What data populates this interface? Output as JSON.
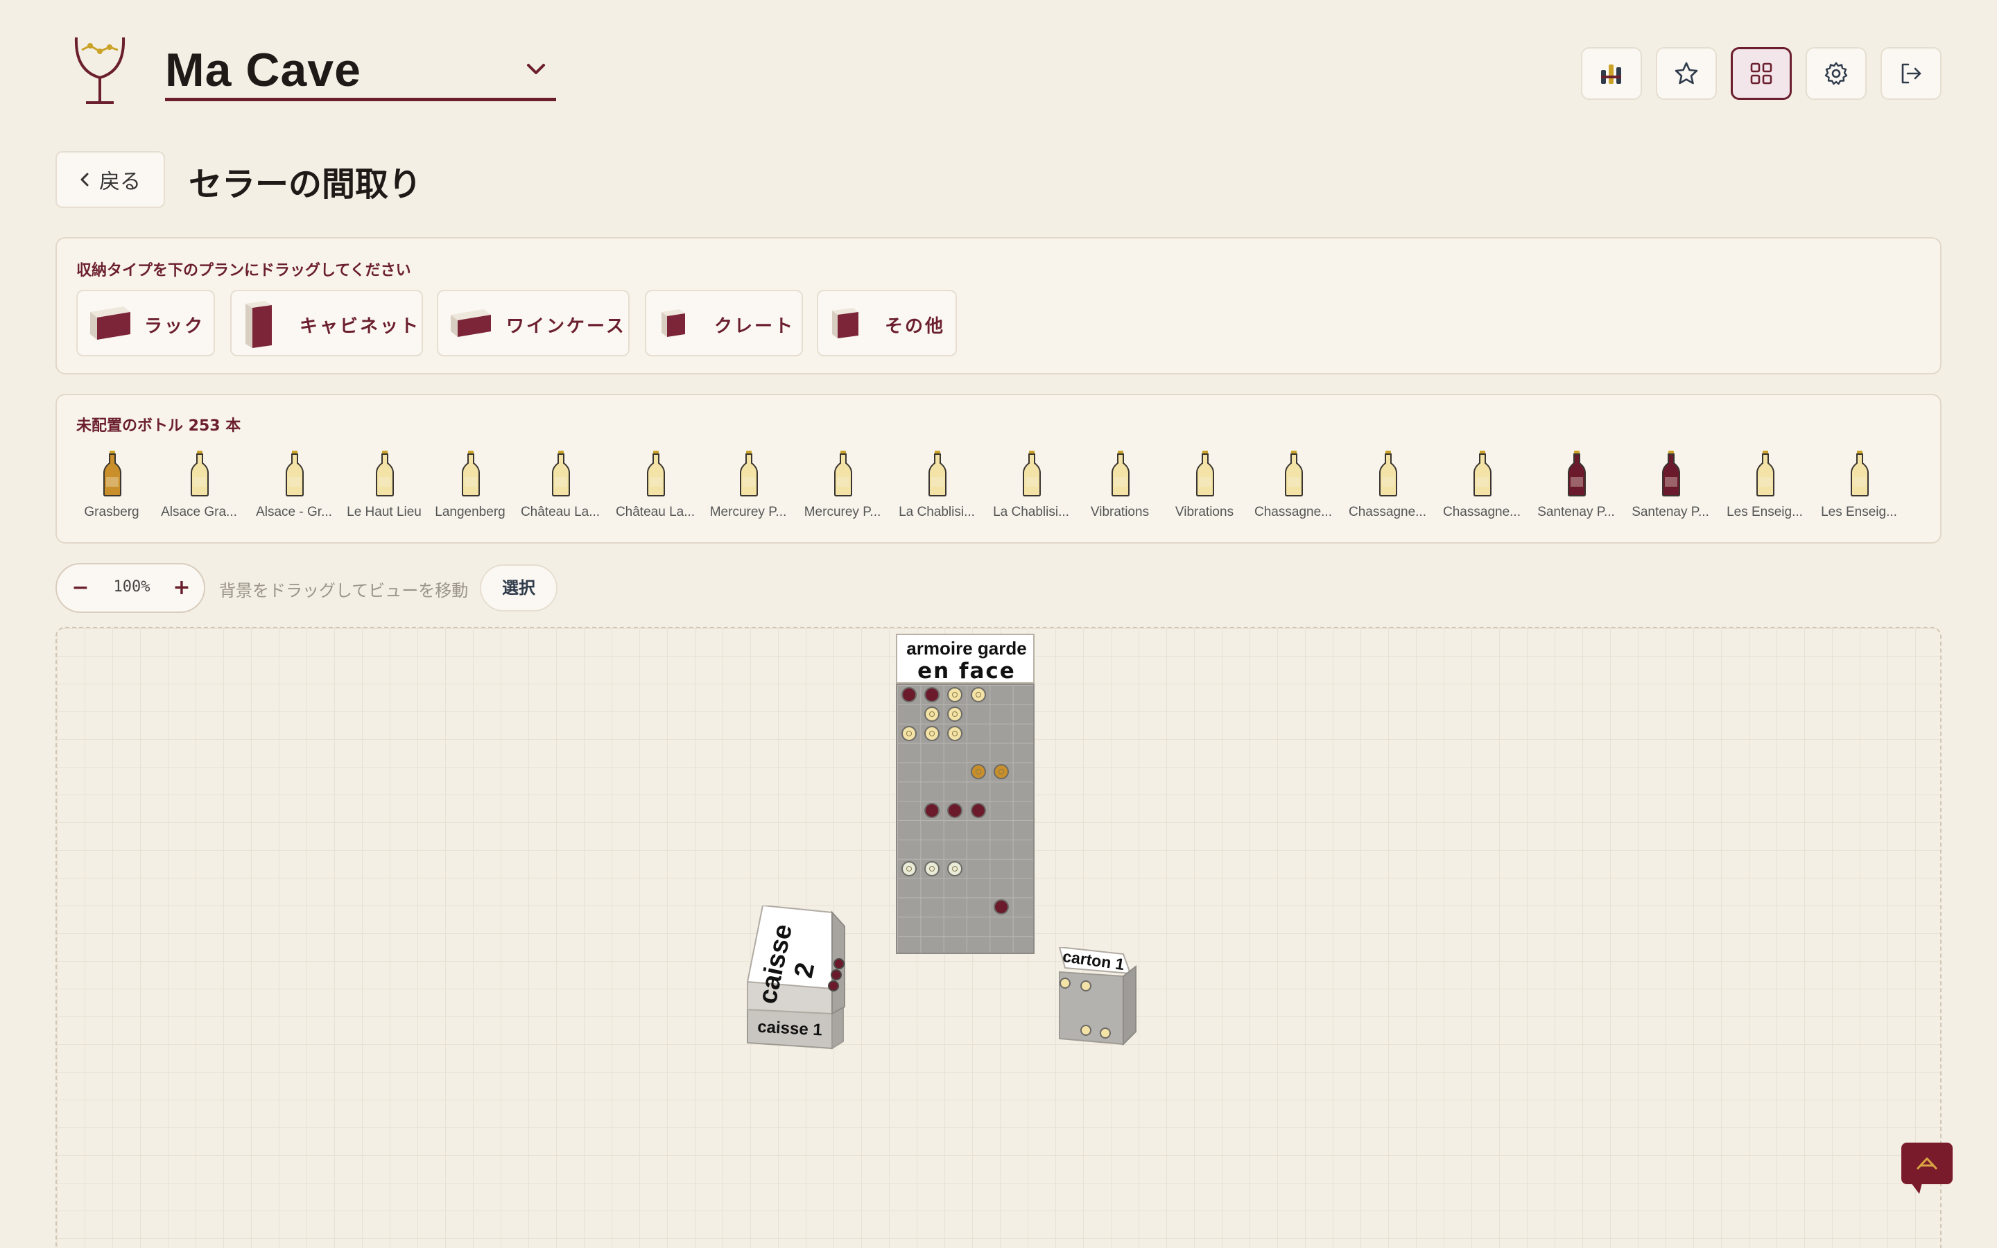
{
  "header": {
    "cellar_name": "Ma Cave",
    "actions": [
      {
        "name": "stats-button",
        "icon": "bottles-chart-icon"
      },
      {
        "name": "favorites-button",
        "icon": "star-icon"
      },
      {
        "name": "layout-button",
        "icon": "grid-icon",
        "active": true
      },
      {
        "name": "settings-button",
        "icon": "gear-icon"
      },
      {
        "name": "logout-button",
        "icon": "logout-icon"
      }
    ]
  },
  "page": {
    "back_label": "戻る",
    "title": "セラーの間取り"
  },
  "storage_types": {
    "instruction": "収納タイプを下のプランにドラッグしてください",
    "items": [
      "ラック",
      "キャビネット",
      "ワインケース",
      "クレート",
      "その他"
    ]
  },
  "unplaced": {
    "title": "未配置のボトル 253 本",
    "bottles": [
      {
        "label": "Grasberg",
        "color": "amber"
      },
      {
        "label": "Alsace Gra...",
        "color": "white"
      },
      {
        "label": "Alsace - Gr...",
        "color": "white"
      },
      {
        "label": "Le Haut Lieu",
        "color": "white"
      },
      {
        "label": "Langenberg",
        "color": "white"
      },
      {
        "label": "Château La...",
        "color": "white"
      },
      {
        "label": "Château La...",
        "color": "white"
      },
      {
        "label": "Mercurey P...",
        "color": "white"
      },
      {
        "label": "Mercurey P...",
        "color": "white"
      },
      {
        "label": "La Chablisi...",
        "color": "white"
      },
      {
        "label": "La Chablisi...",
        "color": "white"
      },
      {
        "label": "Vibrations",
        "color": "white"
      },
      {
        "label": "Vibrations",
        "color": "white"
      },
      {
        "label": "Chassagne...",
        "color": "white"
      },
      {
        "label": "Chassagne...",
        "color": "white"
      },
      {
        "label": "Chassagne...",
        "color": "white"
      },
      {
        "label": "Santenay P...",
        "color": "red"
      },
      {
        "label": "Santenay P...",
        "color": "red"
      },
      {
        "label": "Les Enseig...",
        "color": "white"
      },
      {
        "label": "Les Enseig...",
        "color": "white"
      }
    ]
  },
  "toolbar": {
    "zoom_minus": "−",
    "zoom_plus": "+",
    "zoom": "100%",
    "hint": "背景をドラッグしてビューを移動",
    "select_label": "選択"
  },
  "plan": {
    "cabinet": {
      "label_line1": "armoire garde",
      "label_line2": "en face",
      "columns": 6,
      "rows": 14,
      "slots": [
        {
          "row": 0,
          "col": 0,
          "color": "red"
        },
        {
          "row": 0,
          "col": 1,
          "color": "red"
        },
        {
          "row": 0,
          "col": 2,
          "color": "white"
        },
        {
          "row": 0,
          "col": 3,
          "color": "white"
        },
        {
          "row": 1,
          "col": 1,
          "color": "white"
        },
        {
          "row": 1,
          "col": 2,
          "color": "white"
        },
        {
          "row": 2,
          "col": 0,
          "color": "white"
        },
        {
          "row": 2,
          "col": 1,
          "color": "white"
        },
        {
          "row": 2,
          "col": 2,
          "color": "white"
        },
        {
          "row": 4,
          "col": 3,
          "color": "amber"
        },
        {
          "row": 4,
          "col": 4,
          "color": "amber"
        },
        {
          "row": 6,
          "col": 1,
          "color": "red"
        },
        {
          "row": 6,
          "col": 2,
          "color": "red"
        },
        {
          "row": 6,
          "col": 3,
          "color": "red"
        },
        {
          "row": 9,
          "col": 0,
          "color": "rose"
        },
        {
          "row": 9,
          "col": 1,
          "color": "rose"
        },
        {
          "row": 9,
          "col": 2,
          "color": "rose"
        },
        {
          "row": 11,
          "col": 4,
          "color": "red"
        }
      ]
    },
    "crates": {
      "top_label": "caisse 2",
      "bottom_label": "caisse 1"
    },
    "carton": {
      "label": "carton 1"
    }
  },
  "colors": {
    "accent": "#6b1f2e",
    "red_wine": "#6b1a2b",
    "white_wine": "#f3e3a6",
    "amber_wine": "#c98f2a",
    "rose_wine": "#e9ecd8"
  }
}
